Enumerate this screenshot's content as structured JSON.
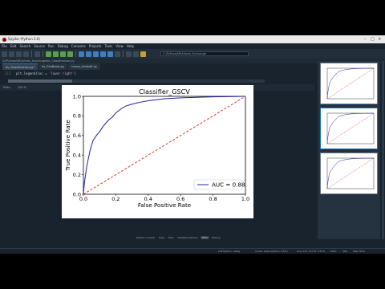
{
  "window": {
    "title": "Spyder (Python 3.6)"
  },
  "menu": [
    "File",
    "Edit",
    "Search",
    "Source",
    "Run",
    "Debug",
    "Consoles",
    "Projects",
    "Tools",
    "View",
    "Help"
  ],
  "toolbar": {
    "path": "C:\\Python\\Ml\\Artemi_Exchange"
  },
  "editor": {
    "path": "D:\\Python\\Ml\\Artemi_Exchange\\ds_Classification.py",
    "tabs": [
      {
        "label": "ds_Classification.py*"
      },
      {
        "label": "ds_GlmBoost.py"
      },
      {
        "label": "heavy_tradeoff.py"
      }
    ],
    "line_number": "113",
    "code_prefix": "plt.legend(loc = ",
    "code_string": "'lower right'",
    "code_suffix": ")"
  },
  "plots": {
    "header": "Plots",
    "zoom": "100 %",
    "bottom_tabs": [
      {
        "label": "Python console",
        "active": false
      },
      {
        "label": "Help",
        "active": false
      },
      {
        "label": "Files",
        "active": false
      },
      {
        "label": "Variable explorer",
        "active": false
      },
      {
        "label": "Plots",
        "active": true
      },
      {
        "label": "History",
        "active": false
      }
    ]
  },
  "chart_data": {
    "type": "line",
    "title": "Classifier_GSCV",
    "xlabel": "False Positive Rate",
    "ylabel": "True Positive Rate",
    "xlim": [
      0,
      1
    ],
    "ylim": [
      0,
      1
    ],
    "xticks": [
      "0.0",
      "0.2",
      "0.4",
      "0.6",
      "0.8",
      "1.0"
    ],
    "yticks": [
      "0.0",
      "0.2",
      "0.4",
      "0.6",
      "0.8",
      "1.0"
    ],
    "legend": "lower right",
    "series": [
      {
        "name": "AUC = 0.88",
        "color": "#1f1fa8",
        "style": "solid",
        "x": [
          0,
          0.005,
          0.01,
          0.015,
          0.02,
          0.03,
          0.04,
          0.05,
          0.06,
          0.08,
          0.1,
          0.12,
          0.15,
          0.18,
          0.2,
          0.23,
          0.26,
          0.3,
          0.35,
          0.4,
          0.45,
          0.5,
          0.55,
          0.6,
          0.7,
          0.8,
          0.9,
          1.0
        ],
        "y": [
          0,
          0.1,
          0.16,
          0.22,
          0.28,
          0.36,
          0.44,
          0.5,
          0.55,
          0.6,
          0.64,
          0.69,
          0.75,
          0.79,
          0.83,
          0.87,
          0.9,
          0.92,
          0.94,
          0.955,
          0.965,
          0.975,
          0.98,
          0.985,
          0.99,
          0.995,
          0.997,
          1.0
        ]
      },
      {
        "name": "",
        "color": "#e03a2a",
        "style": "dashed",
        "x": [
          0,
          1
        ],
        "y": [
          0,
          1
        ]
      }
    ]
  },
  "status": {
    "lsp": "LSP Python: ready",
    "conda": "conda: base (Python 3.6.5)",
    "line": "Line 113, Col 42",
    "encoding": "UTF-8",
    "eol": "CRLF",
    "rw": "RW",
    "mem": "Mem 63%"
  }
}
